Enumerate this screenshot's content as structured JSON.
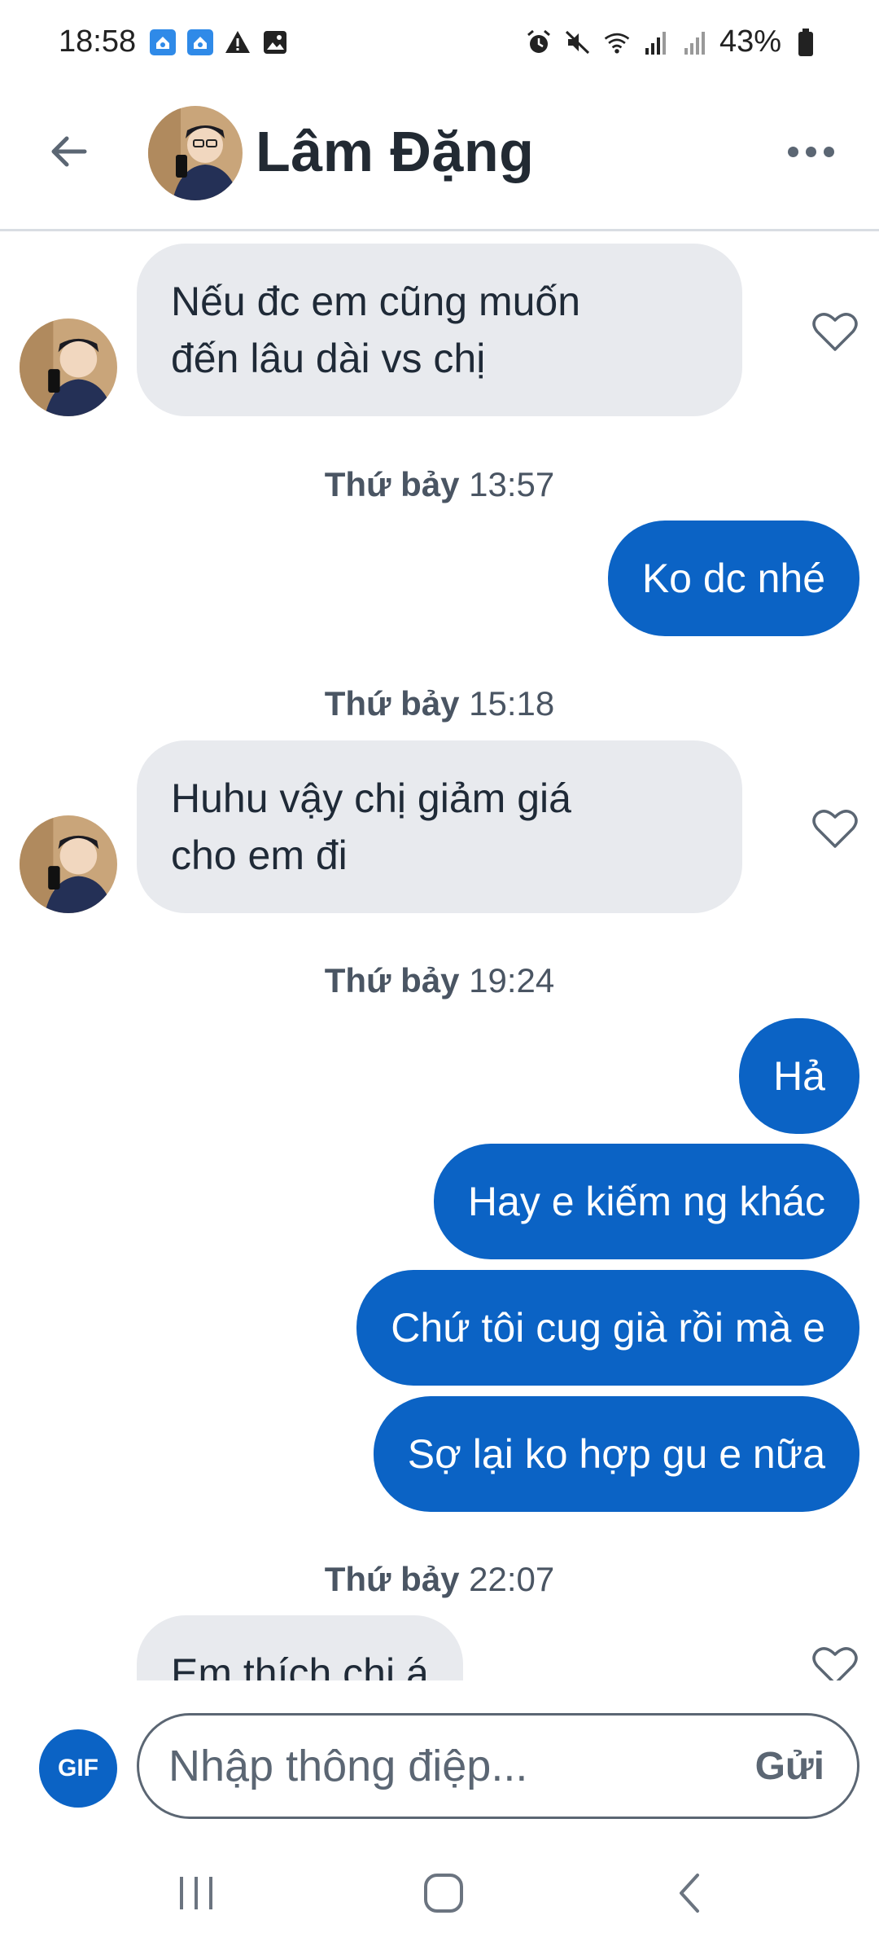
{
  "status_bar": {
    "time": "18:58",
    "battery": "43%"
  },
  "header": {
    "contact_name": "Lâm Đặng"
  },
  "messages": {
    "m1": {
      "line1": "Nếu đc em cũng muốn",
      "line2": "đến lâu dài vs chị"
    },
    "ts1": {
      "day": "Thứ bảy",
      "time": "13:57"
    },
    "m2": "Ko dc nhé",
    "ts2": {
      "day": "Thứ bảy",
      "time": "15:18"
    },
    "m3": {
      "line1": "Huhu vậy chị giảm giá",
      "line2": "cho em đi"
    },
    "ts3": {
      "day": "Thứ bảy",
      "time": "19:24"
    },
    "m4": "Hả",
    "m5": "Hay e kiếm ng khác",
    "m6": "Chứ tôi cug già rồi mà e",
    "m7": "Sợ lại ko hợp gu e nữa",
    "ts4": {
      "day": "Thứ bảy",
      "time": "22:07"
    },
    "m8": "Em thích chị á"
  },
  "composer": {
    "gif_label": "GIF",
    "placeholder": "Nhập thông điệp...",
    "send_label": "Gửi"
  },
  "colors": {
    "outgoing_bubble": "#0b63c5",
    "incoming_bubble": "#e8eaee"
  }
}
